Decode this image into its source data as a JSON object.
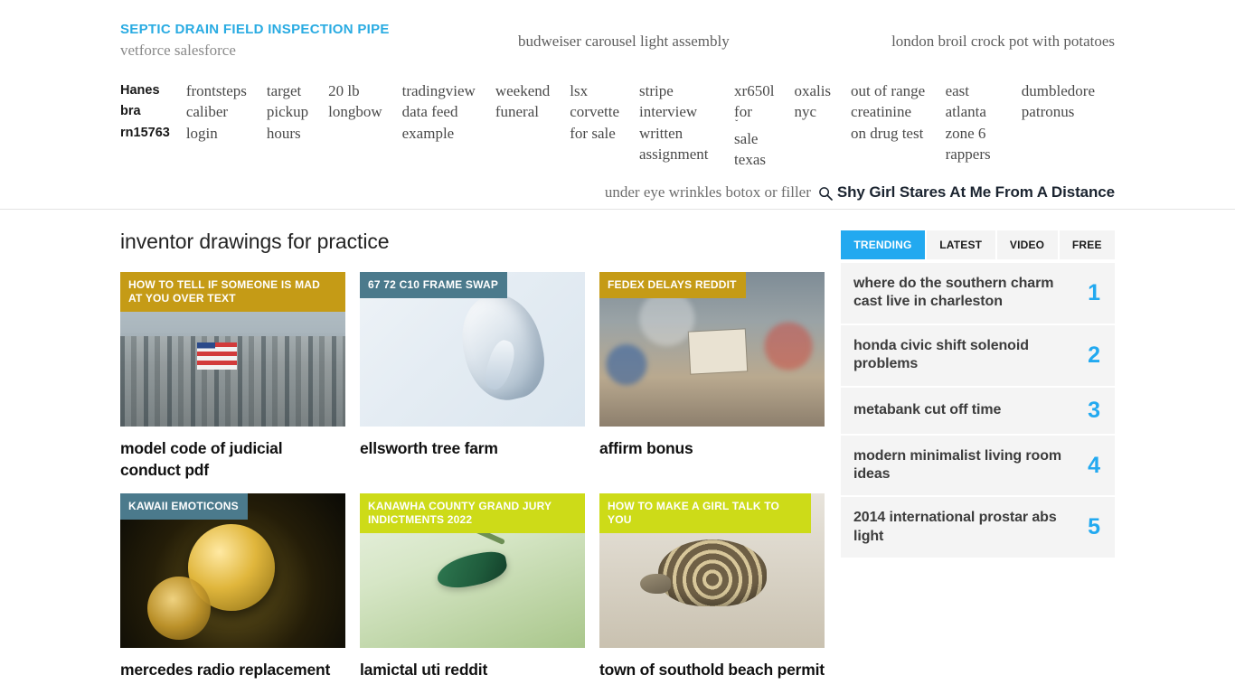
{
  "header": {
    "brand_title": "SEPTIC DRAIN FIELD INSPECTION PIPE",
    "brand_subtitle": "vetforce salesforce",
    "top_links": [
      "budweiser carousel light assembly",
      "london broil crock pot with potatoes"
    ],
    "nav_items": [
      {
        "label": "Hanes bra rn15763",
        "active": true,
        "caret": false
      },
      {
        "label": "frontsteps caliber login",
        "active": false,
        "caret": false
      },
      {
        "label": "target pickup hours",
        "active": false,
        "caret": false
      },
      {
        "label": "20 lb longbow",
        "active": false,
        "caret": false
      },
      {
        "label": "tradingview data feed example",
        "active": false,
        "caret": false
      },
      {
        "label": "weekend funeral",
        "active": false,
        "caret": false
      },
      {
        "label": "lsx corvette for sale",
        "active": false,
        "caret": false
      },
      {
        "label": "stripe interview written assignment",
        "active": false,
        "caret": false
      },
      {
        "label": "xr650l for sale texas",
        "active": false,
        "caret": true
      },
      {
        "label": "oxalis nyc",
        "active": false,
        "caret": false
      },
      {
        "label": "out of range creatinine on drug test",
        "active": false,
        "caret": false
      },
      {
        "label": "east atlanta zone 6 rappers",
        "active": false,
        "caret": false
      },
      {
        "label": "dumbledore patronus",
        "active": false,
        "caret": false
      }
    ],
    "search": {
      "hint": "under eye wrinkles botox or filler",
      "term": "Shy Girl Stares At Me From A Distance",
      "icon": "search-icon"
    }
  },
  "main": {
    "page_title": "inventor drawings for practice",
    "cards": [
      {
        "badge": "HOW TO TELL IF SOMEONE IS MAD AT YOU OVER TEXT",
        "badge_color": "#c59b16",
        "badge_width": "full",
        "title": "model code of judicial conduct pdf",
        "art": "art-refinery"
      },
      {
        "badge": "67 72 C10 FRAME SWAP",
        "badge_color": "#4b7a8c",
        "badge_width": "inline",
        "title": "ellsworth tree farm",
        "art": "art-hand"
      },
      {
        "badge": "FEDEX DELAYS REDDIT",
        "badge_color": "#c59b16",
        "badge_width": "inline",
        "title": "affirm bonus",
        "art": "art-street"
      },
      {
        "badge": "KAWAII EMOTICONS",
        "badge_color": "#4b7a8c",
        "badge_width": "inline",
        "title": "mercedes radio replacement",
        "art": "art-coins"
      },
      {
        "badge": "KANAWHA COUNTY GRAND JURY INDICTMENTS 2022",
        "badge_color": "#cddb18",
        "badge_width": "full",
        "title": "lamictal uti reddit",
        "art": "art-bird"
      },
      {
        "badge": "HOW TO MAKE A GIRL TALK TO YOU",
        "badge_color": "#cddb18",
        "badge_width": "inline",
        "title": "town of southold beach permit",
        "art": "art-tortoise"
      }
    ]
  },
  "sidebar": {
    "tabs": [
      {
        "label": "TRENDING",
        "active": true
      },
      {
        "label": "LATEST",
        "active": false
      },
      {
        "label": "VIDEO",
        "active": false
      },
      {
        "label": "FREE",
        "active": false
      }
    ],
    "trending": [
      {
        "text": "where do the southern charm cast live in charleston",
        "rank": "1"
      },
      {
        "text": "honda civic shift solenoid problems",
        "rank": "2"
      },
      {
        "text": "metabank cut off time",
        "rank": "3"
      },
      {
        "text": "modern minimalist living room ideas",
        "rank": "4"
      },
      {
        "text": "2014 international prostar abs light",
        "rank": "5"
      }
    ]
  },
  "colors": {
    "accent_blue": "#22a9f0",
    "brand_blue": "#29abe2",
    "gold": "#c59b16",
    "slate": "#4b7a8c",
    "lime": "#cddb18"
  }
}
